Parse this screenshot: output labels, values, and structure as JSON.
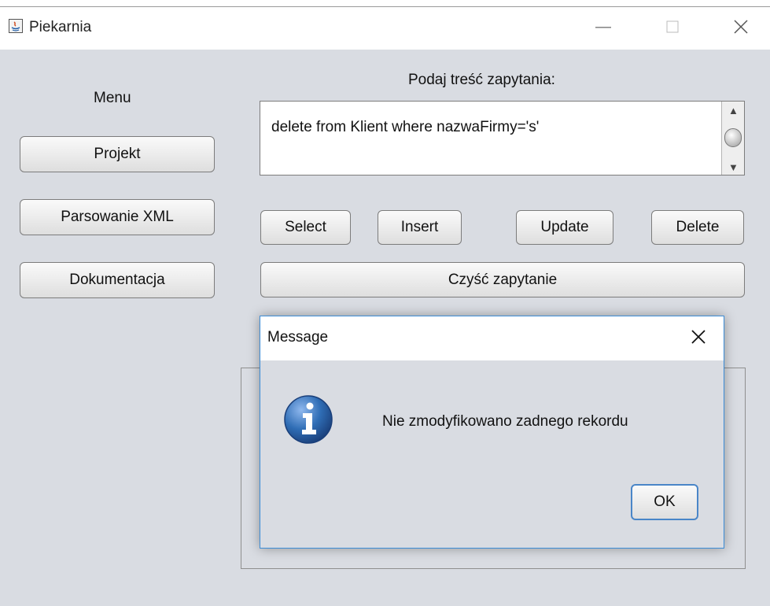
{
  "window": {
    "title": "Piekarnia",
    "icons": [
      "java-app-icon",
      "minimize-icon",
      "maximize-icon",
      "close-icon"
    ]
  },
  "menu": {
    "heading": "Menu",
    "items": [
      {
        "label": "Projekt"
      },
      {
        "label": "Parsowanie XML"
      },
      {
        "label": "Dokumentacja"
      }
    ]
  },
  "query": {
    "prompt": "Podaj treść zapytania:",
    "value": "delete from Klient where nazwaFirmy='s'",
    "actions": [
      {
        "label": "Select"
      },
      {
        "label": "Insert"
      },
      {
        "label": "Update"
      },
      {
        "label": "Delete"
      }
    ],
    "clear_label": "Czyść zapytanie"
  },
  "dialog": {
    "title": "Message",
    "message": "Nie zmodyfikowano zadnego rekordu",
    "ok_label": "OK",
    "icon": "information-icon",
    "colors": {
      "border": "#3c8cd6",
      "icon": "#2f6db5"
    }
  }
}
